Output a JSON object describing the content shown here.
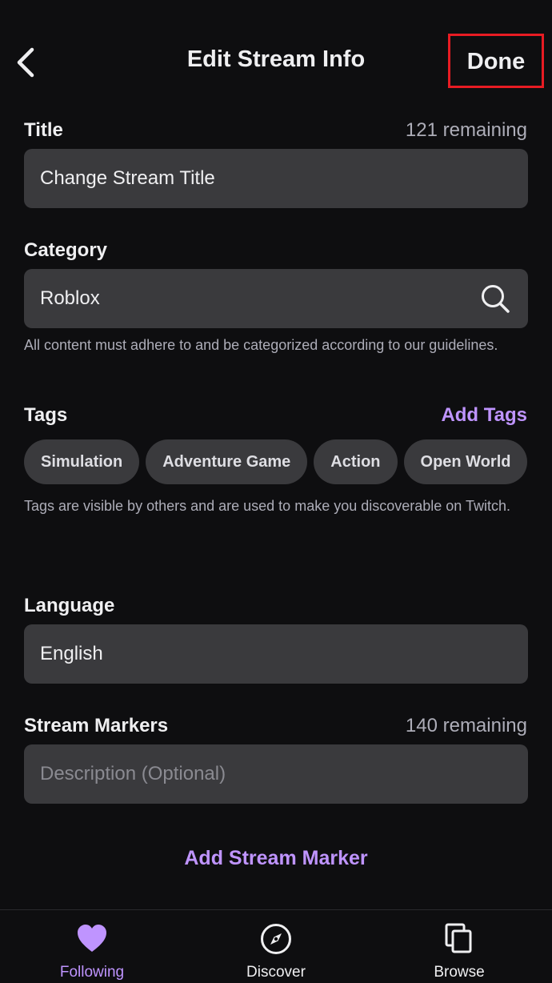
{
  "header": {
    "title": "Edit Stream Info",
    "done_label": "Done"
  },
  "title_section": {
    "label": "Title",
    "remaining": "121 remaining",
    "value": "Change Stream Title"
  },
  "category_section": {
    "label": "Category",
    "value": "Roblox",
    "help": "All content must adhere to and be categorized according to our guidelines."
  },
  "tags_section": {
    "label": "Tags",
    "add_label": "Add Tags",
    "tags": [
      "Simulation",
      "Adventure Game",
      "Action",
      "Open World"
    ],
    "help": "Tags are visible by others and are used to make you discoverable on Twitch."
  },
  "language_section": {
    "label": "Language",
    "value": "English"
  },
  "markers_section": {
    "label": "Stream Markers",
    "remaining": "140 remaining",
    "placeholder": "Description (Optional)",
    "add_label": "Add Stream Marker"
  },
  "tabbar": {
    "following": "Following",
    "discover": "Discover",
    "browse": "Browse"
  },
  "colors": {
    "accent": "#bf94ff",
    "background": "#0e0e10",
    "field": "#3a3a3d",
    "highlight_box": "#e81b23"
  }
}
